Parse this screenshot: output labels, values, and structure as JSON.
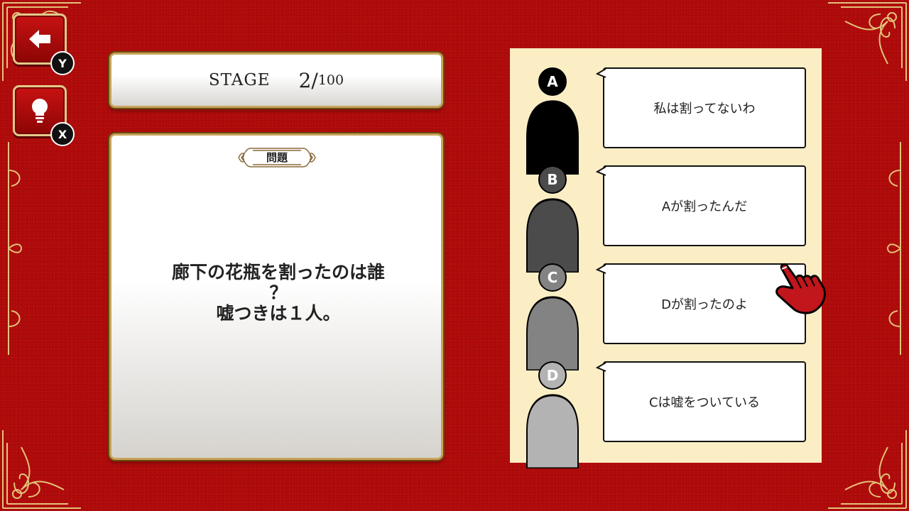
{
  "buttons": {
    "back": {
      "badge": "Y"
    },
    "hint": {
      "badge": "X"
    }
  },
  "stage": {
    "label": "STAGE",
    "current": "2",
    "separator": "/",
    "total": "100"
  },
  "question": {
    "header": "問題",
    "line1": "廊下の花瓶を割ったのは誰",
    "line2": "？",
    "line3": "嘘つきは１人。"
  },
  "suspects": [
    {
      "letter": "A",
      "statement": "私は割ってないわ",
      "color": "#000000"
    },
    {
      "letter": "B",
      "statement": "Aが割ったんだ",
      "color": "#4b4b4b"
    },
    {
      "letter": "C",
      "statement": "Dが割ったのよ",
      "color": "#838383"
    },
    {
      "letter": "D",
      "statement": "Cは嘘をついている",
      "color": "#b3b3b3"
    }
  ],
  "colors": {
    "background": "#b10b0b",
    "gold": "#c8a45a",
    "suspect_panel": "#fbeec5",
    "hand": "#c0161c"
  }
}
